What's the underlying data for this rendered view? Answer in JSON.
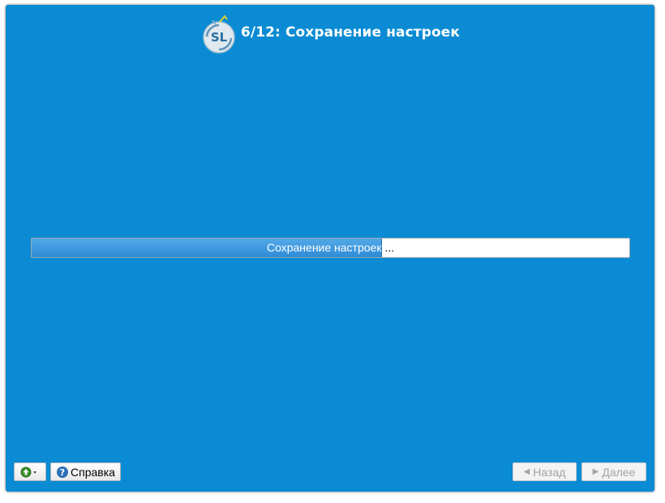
{
  "header": {
    "title": "6/12: Сохранение настроек",
    "logo_text": "SL",
    "logo_icon": "scientific-linux-logo"
  },
  "progress": {
    "label": "Сохранение настроек ...",
    "fraction": 0.585
  },
  "footer": {
    "language_menu_icon": "green-up-arrow-icon",
    "help_label": "Справка",
    "back_label": "Назад",
    "next_label": "Далее"
  },
  "colors": {
    "background": "#0a8bd3",
    "progress_fill": "#3d9ae0",
    "disabled_text": "#a4a4a4"
  }
}
